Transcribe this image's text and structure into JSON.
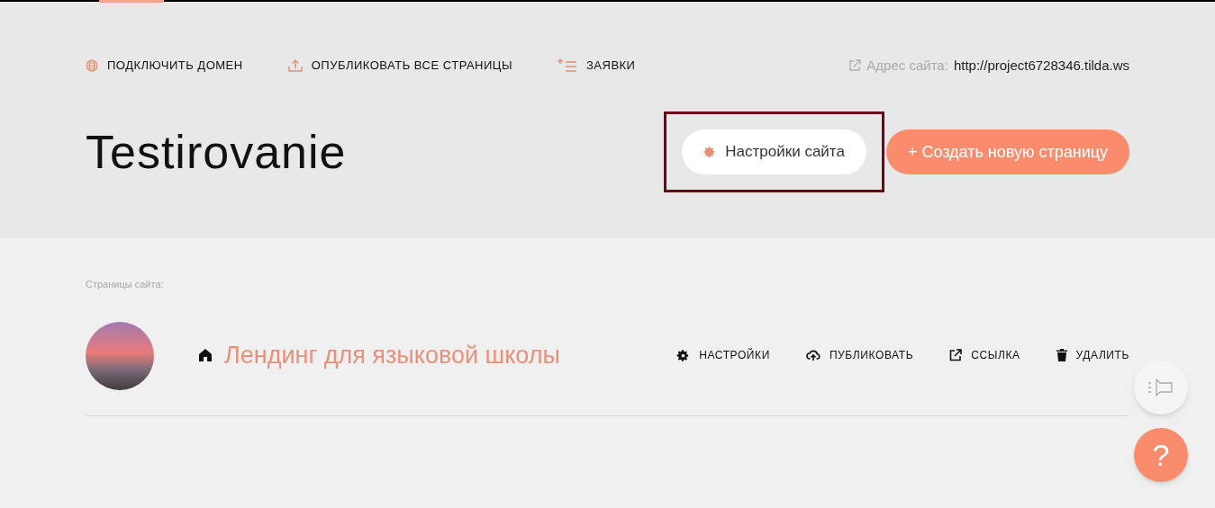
{
  "top_nav": [
    {
      "kind": "globe",
      "label": "ПОДКЛЮЧИТЬ ДОМЕН"
    },
    {
      "kind": "upload",
      "label": "ОПУБЛИКОВАТЬ ВСЕ СТРАНИЦЫ"
    },
    {
      "kind": "list",
      "label": "ЗАЯВКИ"
    }
  ],
  "site_address": {
    "label": "Адрес сайта:",
    "url": "http://project6728346.tilda.ws"
  },
  "project_title": "Testirovanie",
  "settings_button": {
    "label": "Настройки сайта",
    "highlighted": true
  },
  "create_button": {
    "label": "+ Создать новую страницу"
  },
  "pages_heading": "Страницы сайта:",
  "pages": [
    {
      "title": "Лендинг для языковой школы",
      "home": true,
      "actions": [
        {
          "kind": "gear",
          "label": "НАСТРОЙКИ"
        },
        {
          "kind": "cloud",
          "label": "ПУБЛИКОВАТЬ"
        },
        {
          "kind": "link",
          "label": "ССЫЛКА"
        },
        {
          "kind": "trash",
          "label": "УДАЛИТЬ"
        }
      ]
    }
  ],
  "help_button": {
    "label": "?"
  }
}
